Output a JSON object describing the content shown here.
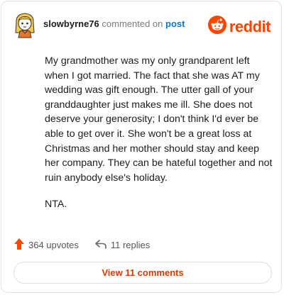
{
  "header": {
    "username": "slowbyrne76",
    "action_text": "commented on",
    "post_link": "post",
    "brand": "reddit"
  },
  "comment": {
    "paragraphs": [
      "My grandmother was my only grandparent left when I got married. The fact that she was AT my wedding was gift enough. The utter gall of your granddaughter just makes me ill. She does not deserve your generosity; I don't think I'd ever be able to get over it. She won't be a great loss at Christmas and her mother should stay and keep her company. They can be hateful together and not ruin anybody else's holiday.",
      "NTA."
    ]
  },
  "footer": {
    "upvotes": "364 upvotes",
    "replies": "11 replies",
    "view_comments": "View 11 comments"
  },
  "colors": {
    "brand": "#ff4500",
    "link": "#0079d3",
    "view_button_text": "#d93a00"
  }
}
